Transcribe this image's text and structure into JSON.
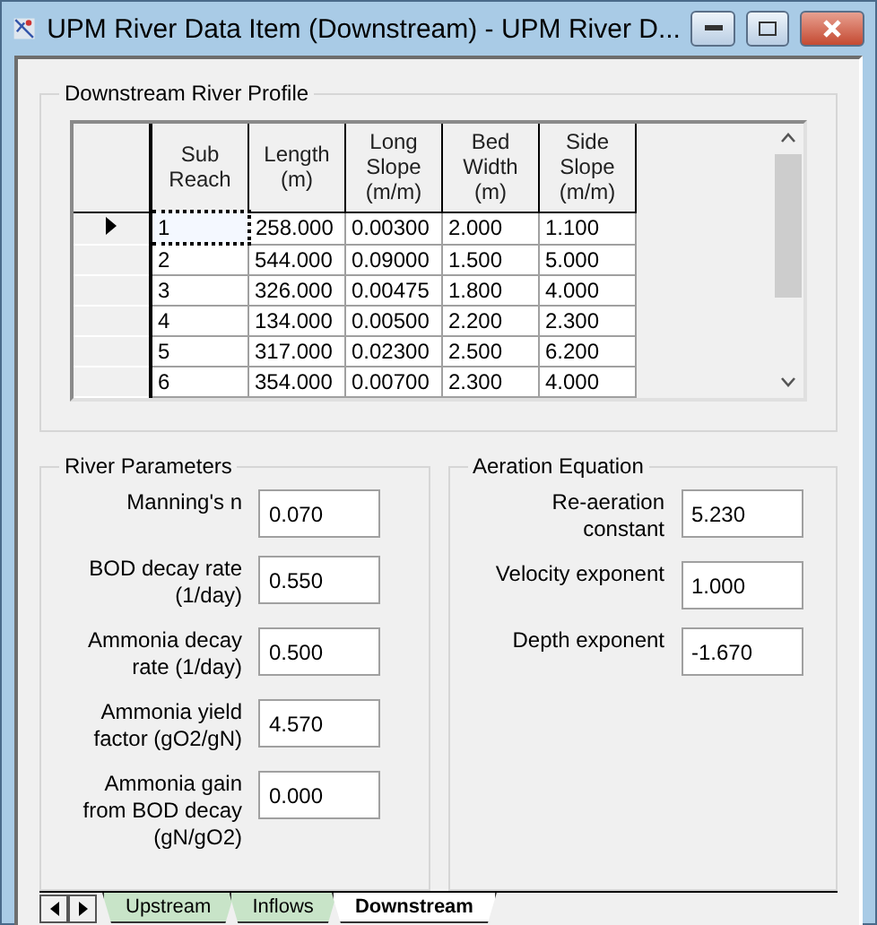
{
  "window": {
    "title": "UPM River Data Item (Downstream) - UPM River D..."
  },
  "profile": {
    "title": "Downstream River Profile",
    "columns": [
      {
        "label": "Sub Reach"
      },
      {
        "label": "Length (m)"
      },
      {
        "label": "Long Slope (m/m)"
      },
      {
        "label": "Bed Width (m)"
      },
      {
        "label": "Side Slope (m/m)"
      }
    ],
    "rows": [
      {
        "selected": true,
        "cells": [
          "1",
          "258.000",
          "0.00300",
          "2.000",
          "1.100"
        ]
      },
      {
        "selected": false,
        "cells": [
          "2",
          "544.000",
          "0.09000",
          "1.500",
          "5.000"
        ]
      },
      {
        "selected": false,
        "cells": [
          "3",
          "326.000",
          "0.00475",
          "1.800",
          "4.000"
        ]
      },
      {
        "selected": false,
        "cells": [
          "4",
          "134.000",
          "0.00500",
          "2.200",
          "2.300"
        ]
      },
      {
        "selected": false,
        "cells": [
          "5",
          "317.000",
          "0.02300",
          "2.500",
          "6.200"
        ]
      },
      {
        "selected": false,
        "cells": [
          "6",
          "354.000",
          "0.00700",
          "2.300",
          "4.000"
        ]
      }
    ]
  },
  "river_parameters": {
    "title": "River Parameters",
    "fields": [
      {
        "label": "Manning's n",
        "value": "0.070"
      },
      {
        "label": "BOD decay rate (1/day)",
        "value": "0.550"
      },
      {
        "label": "Ammonia decay rate (1/day)",
        "value": "0.500"
      },
      {
        "label": "Ammonia yield factor (gO2/gN)",
        "value": "4.570"
      },
      {
        "label": "Ammonia gain from BOD decay (gN/gO2)",
        "value": "0.000"
      }
    ]
  },
  "aeration_equation": {
    "title": "Aeration Equation",
    "fields": [
      {
        "label": "Re-aeration constant",
        "value": "5.230"
      },
      {
        "label": "Velocity exponent",
        "value": "1.000"
      },
      {
        "label": "Depth exponent",
        "value": "-1.670"
      }
    ]
  },
  "tabs": [
    {
      "label": "Upstream",
      "selected": false
    },
    {
      "label": "Inflows",
      "selected": false
    },
    {
      "label": "Downstream",
      "selected": true
    }
  ]
}
